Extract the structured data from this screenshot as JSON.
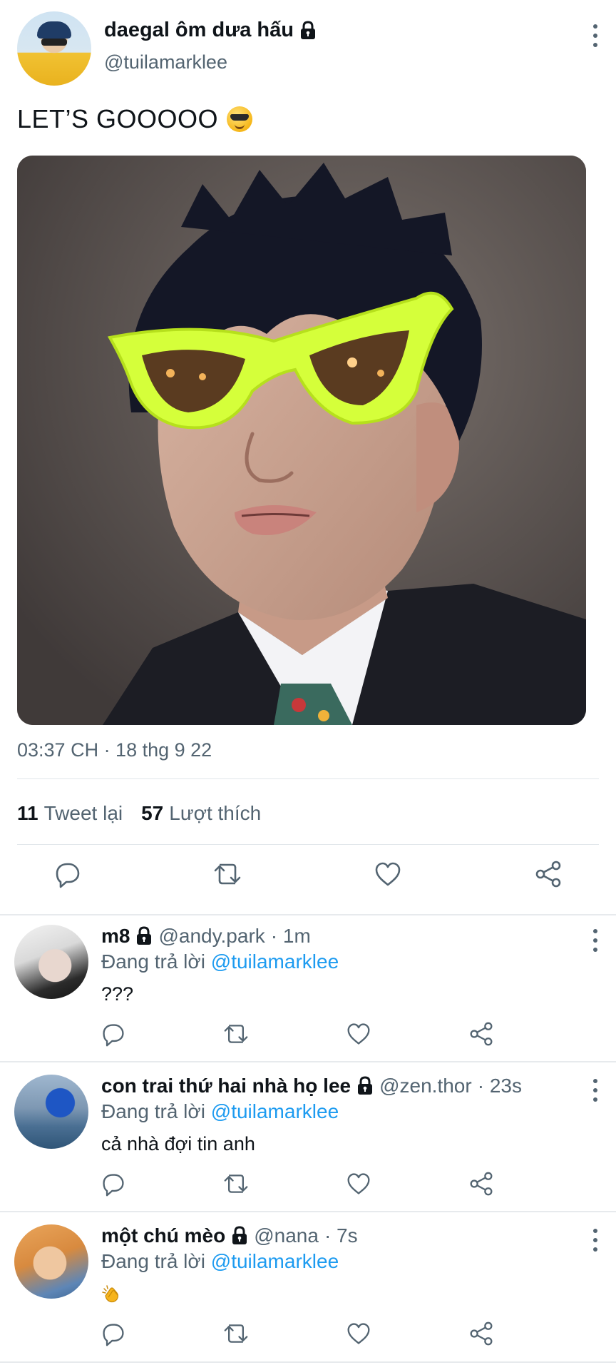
{
  "tweet": {
    "author_name": "daegal ôm dưa hấu",
    "author_handle": "@tuilamarklee",
    "text": "LET’S GOOOOO",
    "emoji": "smiling-face-with-sunglasses",
    "timestamp": "03:37 CH · 18 thg 9 22",
    "retweets_count": "11",
    "retweets_label": "Tweet lại",
    "likes_count": "57",
    "likes_label": "Lượt thích"
  },
  "replies": [
    {
      "name": "m8",
      "handle": "@andy.park",
      "time": "· 1m",
      "replying_prefix": "Đang trả lời",
      "replying_to": "@tuilamarklee",
      "text": "???"
    },
    {
      "name": "con trai thứ hai nhà họ lee",
      "handle": "@zen.thor",
      "time": "· 23s",
      "replying_prefix": "Đang trả lời",
      "replying_to": "@tuilamarklee",
      "text": "cả nhà đợi tin anh"
    },
    {
      "name": "một chú mèo",
      "handle": "@nana",
      "time": "· 7s",
      "replying_prefix": "Đang trả lời",
      "replying_to": "@tuilamarklee",
      "text": "",
      "emoji": "clapping-hands"
    }
  ],
  "colors": {
    "accent": "#1d9bf0",
    "secondary_text": "#536471",
    "primary_text": "#0f1419",
    "divider": "#e1e6ea"
  }
}
